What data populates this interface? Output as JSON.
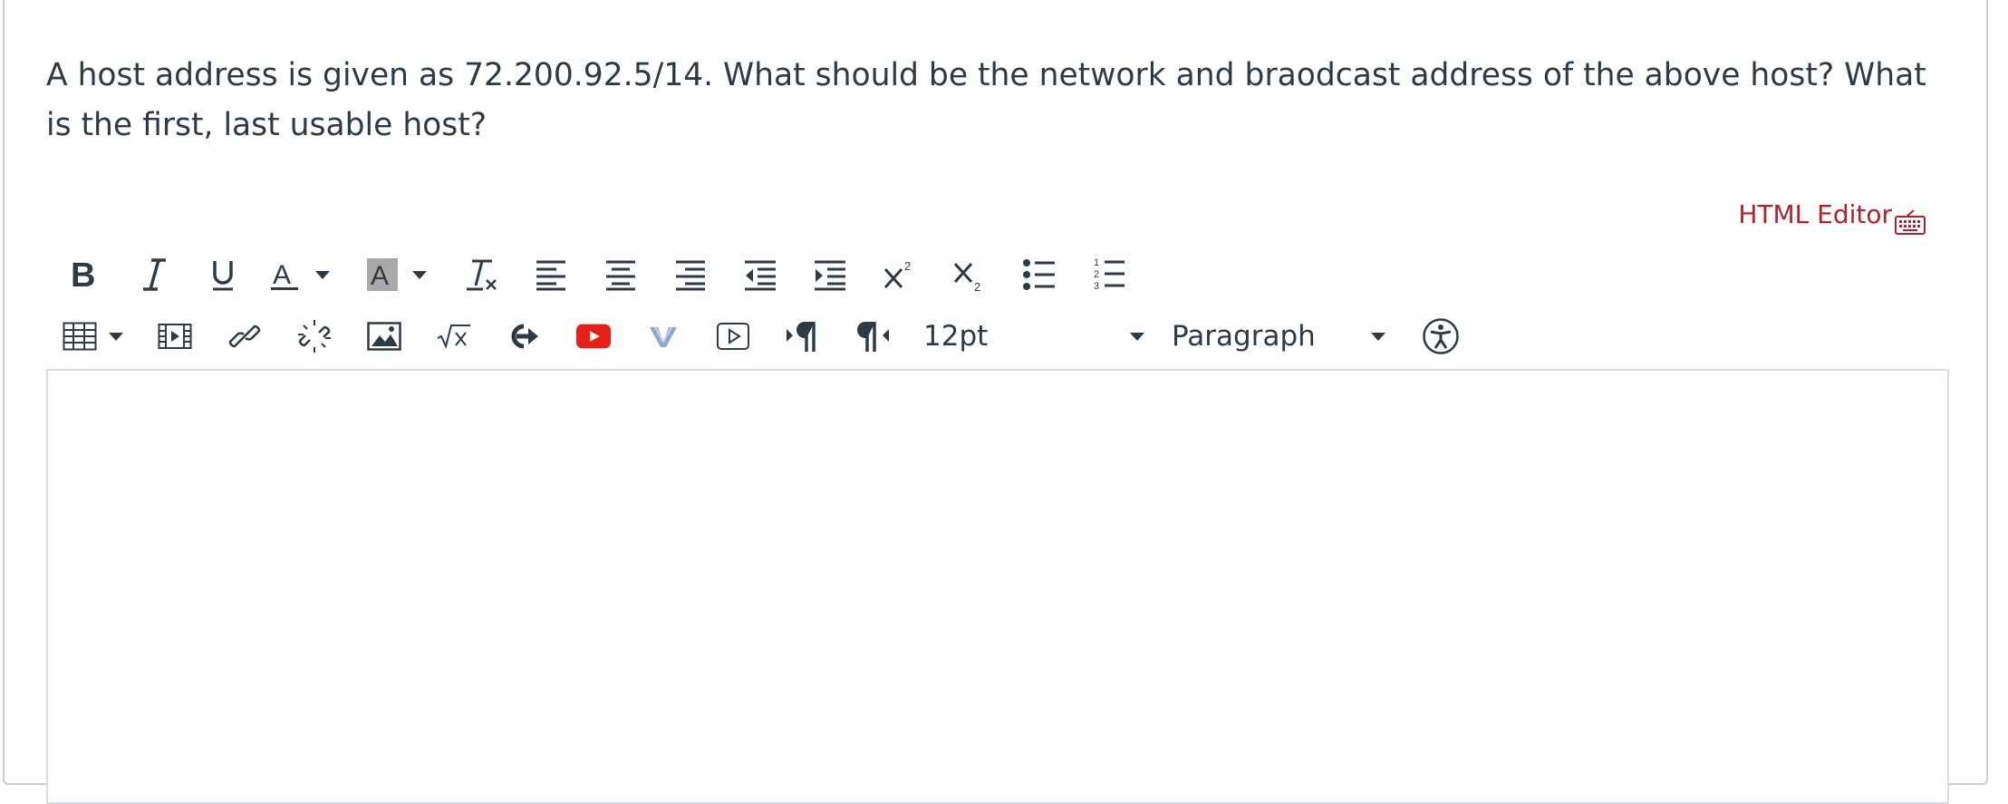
{
  "question": {
    "text": "A host address is given as 72.200.92.5/14. What should be the network and braodcast address of the above host? What is the first, last usable host?"
  },
  "editor": {
    "html_editor_label": "HTML Editor",
    "font_size": "12pt",
    "block_format": "Paragraph",
    "accent_color": "#b5202e",
    "icon_color": "#2d3b45"
  },
  "toolbar": {
    "row1": [
      "bold-icon",
      "italic-icon",
      "underline-icon",
      "text-color-icon",
      "caret-down-icon",
      "background-color-icon",
      "caret-down-icon",
      "clear-formatting-icon",
      "align-left-icon",
      "align-center-icon",
      "align-right-icon",
      "outdent-icon",
      "indent-icon",
      "superscript-icon",
      "subscript-icon",
      "bullet-list-icon",
      "numbered-list-icon"
    ],
    "row2": [
      "table-icon",
      "caret-down-icon",
      "media-icon",
      "link-icon",
      "unlink-icon",
      "image-icon",
      "equation-icon",
      "lti-redirect-icon",
      "youtube-icon",
      "vimeo-icon",
      "media-player-icon",
      "ltr-icon",
      "rtl-icon",
      "accessibility-icon"
    ]
  }
}
